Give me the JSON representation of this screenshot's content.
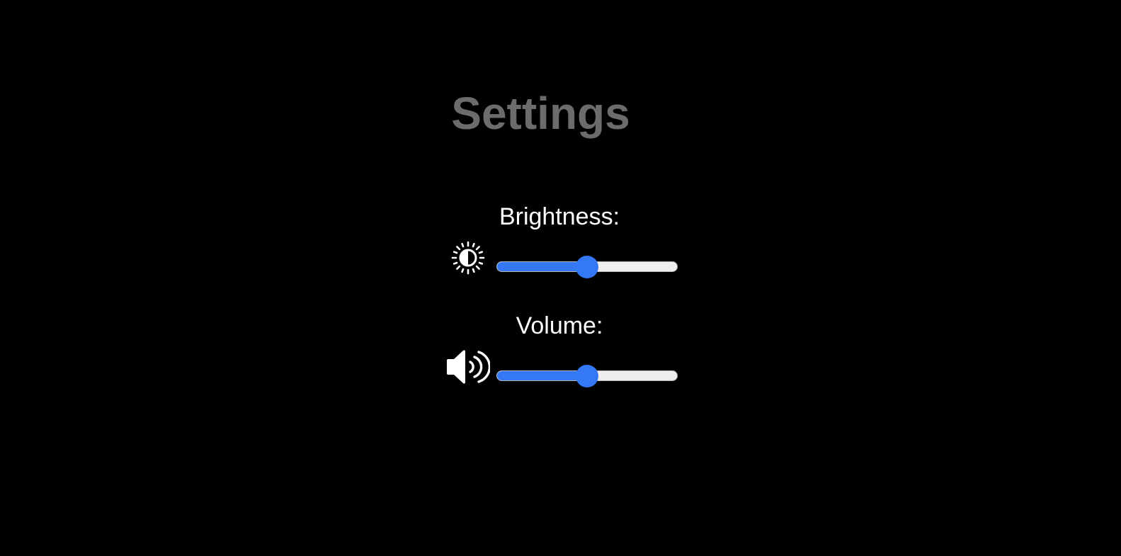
{
  "page": {
    "title": "Settings",
    "title_color": "#6c6c6c",
    "background": "#000000"
  },
  "settings": {
    "brightness": {
      "label": "Brightness:",
      "icon": "brightness-icon",
      "value_percent": 50
    },
    "volume": {
      "label": "Volume:",
      "icon": "speaker-volume-icon",
      "value_percent": 50
    }
  },
  "colors": {
    "accent": "#3478f6",
    "track": "#efefef",
    "text": "#ffffff"
  }
}
